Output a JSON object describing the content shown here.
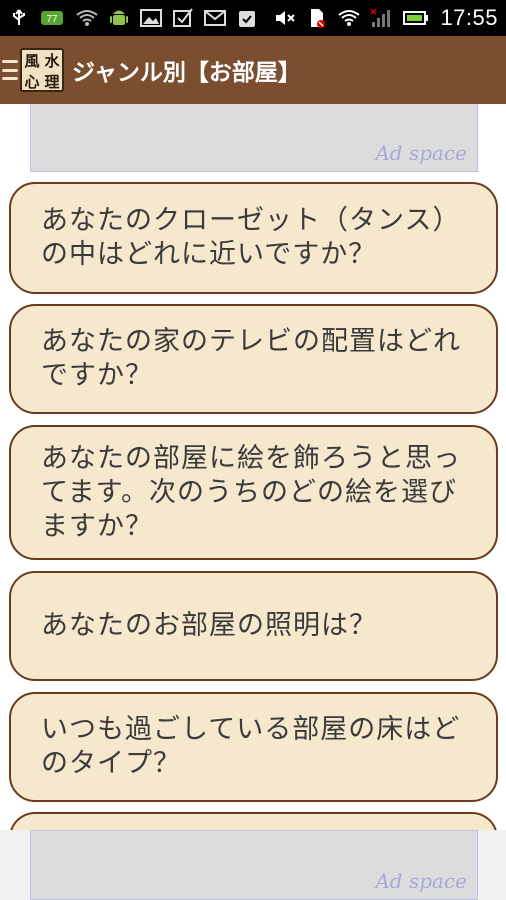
{
  "status_bar": {
    "time": "17:55",
    "icons_left": [
      "usb-icon",
      "battery-badge-icon",
      "wifi-icon",
      "android-icon",
      "image-icon",
      "checkbox-icon",
      "mail-icon",
      "clipboard-icon"
    ],
    "icons_right": [
      "mute-icon",
      "no-sim-icon",
      "wifi-signal-icon",
      "cell-signal-icon",
      "battery-icon"
    ],
    "battery_badge": "77"
  },
  "app_bar": {
    "logo_chars": [
      "風",
      "水",
      "心",
      "理"
    ],
    "title": "ジャンル別【お部屋】"
  },
  "ads": {
    "top_label": "Ad space",
    "bottom_label": "Ad space"
  },
  "questions": [
    {
      "text": "あなたのクローゼット（タンス）の中はどれに近いですか？"
    },
    {
      "text": "あなたの家のテレビの配置はどれですか？"
    },
    {
      "text": "あなたの部屋に絵を飾ろうと思ってます。次のうちのどの絵を選びますか？"
    },
    {
      "text": "あなたのお部屋の照明は？"
    },
    {
      "text": "いつも過ごしている部屋の床はどのタイプ？"
    }
  ],
  "colors": {
    "app_bar": "#7a4e2e",
    "card_bg": "#f5e8cd",
    "card_border": "#6b3a1f",
    "ad_label": "#a8a8d8"
  }
}
